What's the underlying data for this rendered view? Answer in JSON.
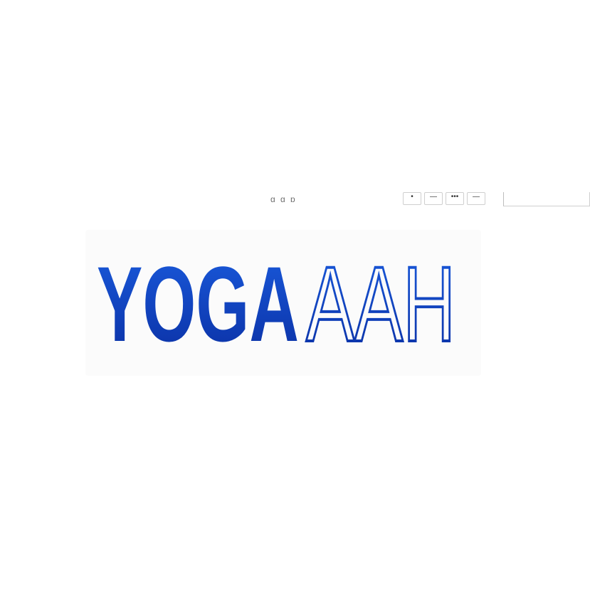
{
  "topbar": {
    "links_text": "g   g     p",
    "toolbar_buttons": [
      {
        "name": "toolbar-button-1",
        "glyph": ""
      },
      {
        "name": "toolbar-button-2",
        "glyph": ""
      },
      {
        "name": "toolbar-button-3",
        "glyph": ""
      },
      {
        "name": "toolbar-button-4",
        "glyph": ""
      }
    ],
    "search": {
      "value": "",
      "placeholder": ""
    }
  },
  "logo": {
    "text_bold": "YOGA",
    "text_light": "AAH",
    "colors": {
      "gradient_top": "#1a5bdd",
      "gradient_bottom": "#0a2fa3"
    }
  }
}
